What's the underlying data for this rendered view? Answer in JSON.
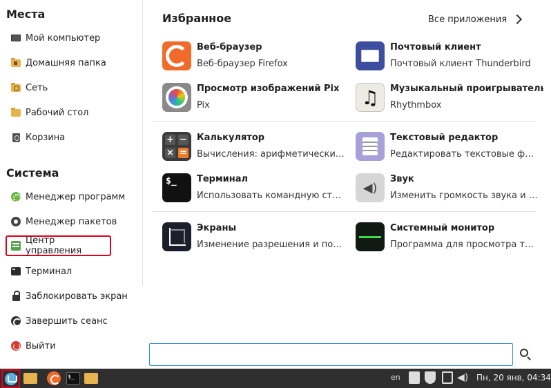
{
  "sidebar": {
    "places_title": "Места",
    "places": [
      {
        "label": "Мой компьютер",
        "icon": "computer-icon"
      },
      {
        "label": "Домашняя папка",
        "icon": "home-folder-icon"
      },
      {
        "label": "Сеть",
        "icon": "network-folder-icon"
      },
      {
        "label": "Рабочий стол",
        "icon": "desktop-folder-icon"
      },
      {
        "label": "Корзина",
        "icon": "trash-icon"
      }
    ],
    "system_title": "Система",
    "system": [
      {
        "label": "Менеджер программ",
        "icon": "software-manager-icon"
      },
      {
        "label": "Менеджер пакетов",
        "icon": "package-manager-icon"
      },
      {
        "label": "Центр управления",
        "icon": "control-center-icon",
        "selected": true
      },
      {
        "label": "Терминал",
        "icon": "terminal-icon"
      },
      {
        "label": "Заблокировать экран",
        "icon": "lock-icon"
      },
      {
        "label": "Завершить сеанс",
        "icon": "logout-icon"
      },
      {
        "label": "Выйти",
        "icon": "power-icon"
      }
    ]
  },
  "favorites": {
    "title": "Избранное",
    "all_apps_label": "Все приложения",
    "apps": [
      {
        "name": "Веб-браузер",
        "desc": "Веб-браузер Firefox",
        "icon": "firefox-icon"
      },
      {
        "name": "Почтовый клиент",
        "desc": "Почтовый клиент Thunderbird",
        "icon": "mail-icon"
      },
      {
        "name": "Просмотр изображений Pix",
        "desc": "Pix",
        "icon": "pix-icon"
      },
      {
        "name": "Музыкальный проигрыватель",
        "desc": "Rhythmbox",
        "icon": "music-icon"
      },
      {
        "name": "Калькулятор",
        "desc": "Вычисления: арифметические, научные или финансовые",
        "icon": "calculator-icon"
      },
      {
        "name": "Текстовый редактор",
        "desc": "Редактировать текстовые файлы",
        "icon": "text-editor-icon"
      },
      {
        "name": "Терминал",
        "desc": "Использовать командную строку",
        "icon": "terminal-icon"
      },
      {
        "name": "Звук",
        "desc": "Изменить громкость звука и сигналы",
        "icon": "sound-icon"
      },
      {
        "name": "Экраны",
        "desc": "Изменение разрешения и позиции мониторов",
        "icon": "displays-icon"
      },
      {
        "name": "Системный монитор",
        "desc": "Программа для просмотра текущих процессов",
        "icon": "system-monitor-icon"
      }
    ]
  },
  "search": {
    "value": "",
    "placeholder": ""
  },
  "taskbar": {
    "language": "en",
    "clock": "Пн, 20 янв, 04:34"
  }
}
